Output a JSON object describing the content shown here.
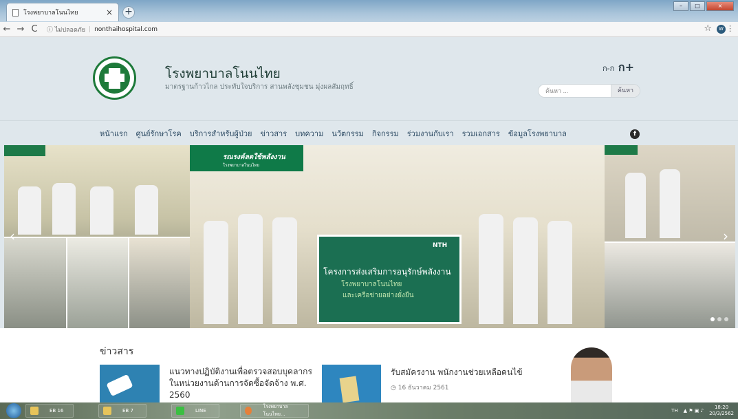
{
  "browser": {
    "tab_title": "โรงพยาบาลโนนไทย",
    "tab_close": "×",
    "new_tab": "+",
    "security_label": "ไม่ปลอดภัย",
    "url": "nonthaihospital.com",
    "profile_initial": "W"
  },
  "site": {
    "title": "โรงพยาบาลโนนไทย",
    "tagline": "มาตรฐานก้าวไกล ประทับใจบริการ สานพลังชุมชน มุ่งผลสัมฤทธิ์",
    "font_size_small": "ก-ก",
    "font_size_large": "ก+",
    "search_placeholder": "ค้นหา ...",
    "search_button": "ค้นหา"
  },
  "nav": {
    "items": [
      "หน้าแรก",
      "ศูนย์รักษาโรค",
      "บริการสำหรับผู้ป่วย",
      "ข่าวสาร",
      "บทความ",
      "นวัตกรรม",
      "กิจกรรม",
      "ร่วมงานกับเรา",
      "รวมเอกสาร",
      "ข้อมูลโรงพยาบาล"
    ],
    "facebook": "f"
  },
  "banner": {
    "header_text": "รณรงค์ลดใช้พลังงาน",
    "header_sub": "โรงพยาบาลโนนไทย",
    "nth_label": "NTH",
    "campaign_title": "โครงการส่งเสริมการอนุรักษ์พลังงาน",
    "campaign_sub1": "โรงพยาบาลโนนไทย",
    "campaign_sub2": "และเครือข่ายอย่างยั่งยืน",
    "prev_arrow": "‹",
    "next_arrow": "›"
  },
  "news": {
    "heading": "ข่าวสาร",
    "items": [
      {
        "title": "แนวทางปฏิบัติงานเพื่อตรวจสอบบุคลากรในหน่วยงานด้านการจัดซื้อจัดจ้าง พ.ศ. 2560"
      },
      {
        "title": "รับสมัครงาน พนักงานช่วยเหลือคนไข้",
        "date": "16 ธันวาคม 2561"
      }
    ]
  },
  "taskbar": {
    "items": [
      "EB 16",
      "EB 7",
      "LINE",
      "โรงพยาบาลโนนไทย..."
    ],
    "lang": "TH",
    "time": "18:20",
    "date": "20/3/2562"
  }
}
